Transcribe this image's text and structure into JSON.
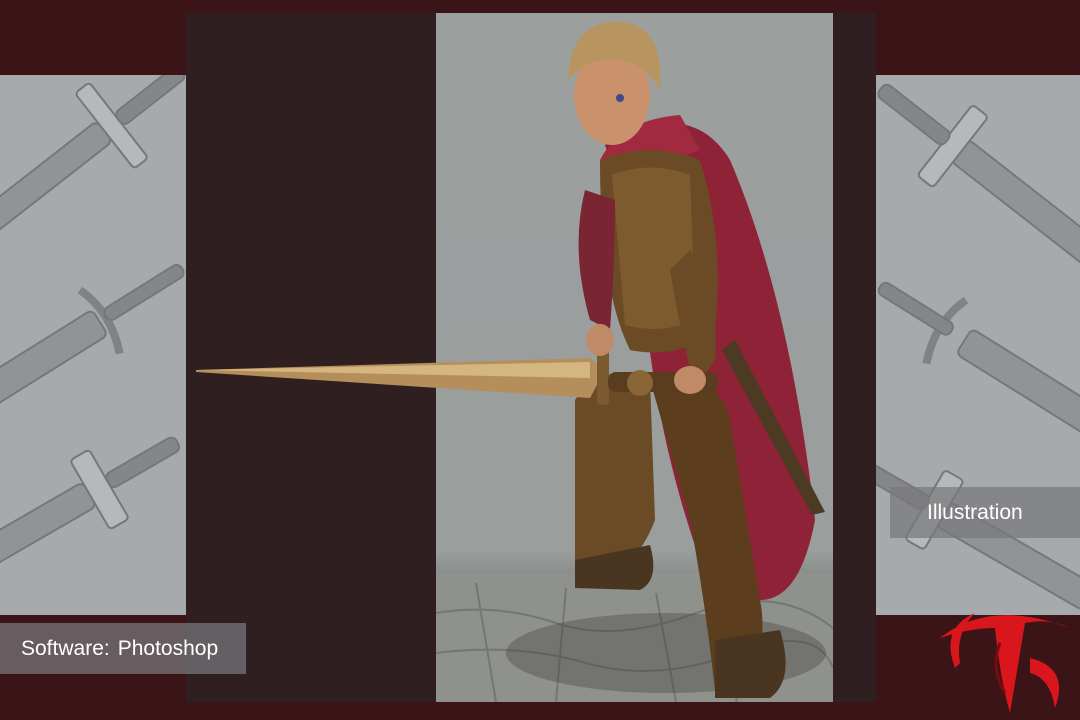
{
  "labels": {
    "software_key": "Software:",
    "software_value": "Photoshop",
    "category": "Illustration"
  },
  "logo": {
    "description_icon": "red-stylized-t-logo"
  },
  "colors": {
    "background": "#3a1416",
    "frame": "#2f1f21",
    "side_panel": "#a7aaac",
    "art_background": "#9b9f9e",
    "logo_red": "#d8161b",
    "cape": "#8e2236",
    "armor": "#6b4a26"
  }
}
